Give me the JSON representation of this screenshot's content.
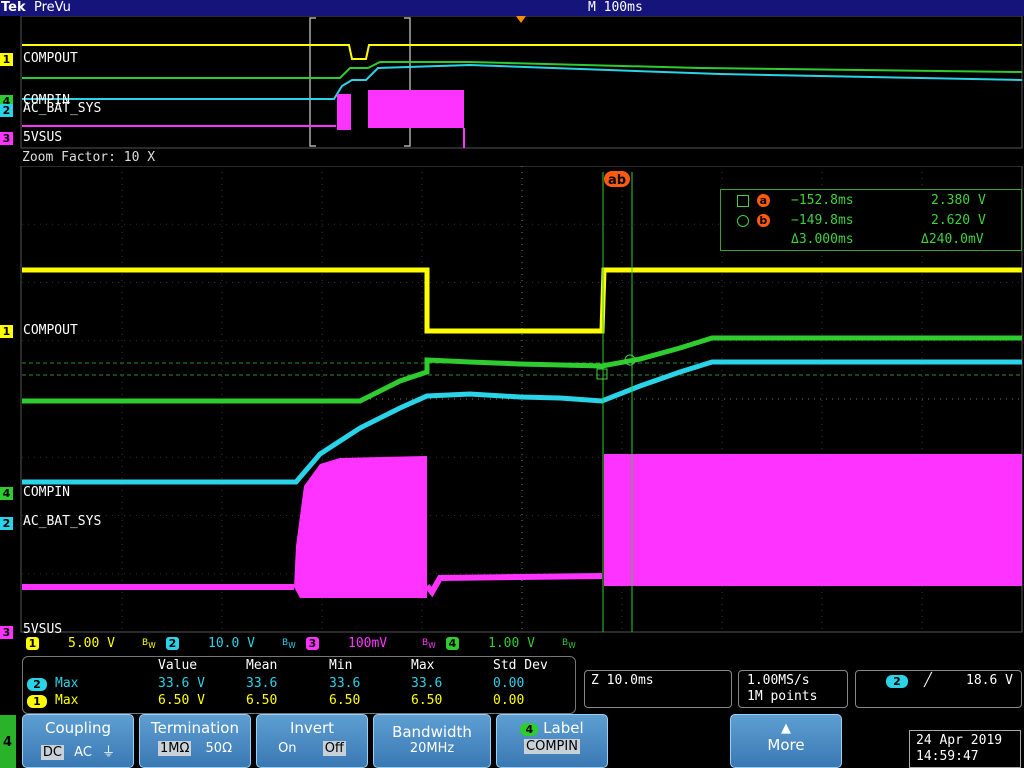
{
  "header": {
    "brand": "Tek",
    "mode": "PreVu",
    "timebase": "M 100ms"
  },
  "overview": {
    "labels": [
      {
        "mark": "1",
        "text": "COMPOUT",
        "color": "#ffff00"
      },
      {
        "mark": "4",
        "text": "COMPIN",
        "color": "#2ecc2e"
      },
      {
        "mark": "2",
        "text": "AC_BAT_SYS",
        "color": "#2ad4e8"
      },
      {
        "mark": "3",
        "text": "5VSUS",
        "color": "#ff33ff"
      }
    ]
  },
  "zoom": {
    "factor_text": "Zoom Factor: 10 X",
    "labels": [
      {
        "mark": "1",
        "text": "COMPOUT",
        "color": "#ffff00"
      },
      {
        "mark": "4",
        "text": "COMPIN",
        "color": "#2ecc2e"
      },
      {
        "mark": "2",
        "text": "AC_BAT_SYS",
        "color": "#2ad4e8"
      },
      {
        "mark": "3",
        "text": "5VSUS",
        "color": "#ff33ff"
      }
    ],
    "cursor_marker": "ab"
  },
  "cursors": {
    "a": {
      "badge": "a",
      "time": "−152.8ms",
      "value": "2.380 V"
    },
    "b": {
      "badge": "b",
      "time": "−149.8ms",
      "value": "2.620 V"
    },
    "delta_time": "Δ3.000ms",
    "delta_value": "Δ240.0mV"
  },
  "scales": [
    {
      "ch": "1",
      "value": "5.00 V",
      "color": "#ffff00"
    },
    {
      "ch": "2",
      "value": "10.0 V",
      "color": "#2ad4e8"
    },
    {
      "ch": "3",
      "value": "100mV",
      "color": "#ff33ff"
    },
    {
      "ch": "4",
      "value": "1.00 V",
      "color": "#2ecc2e"
    }
  ],
  "measurements": {
    "headers": [
      "Value",
      "Mean",
      "Min",
      "Max",
      "Std Dev"
    ],
    "rows": [
      {
        "ch": "2",
        "name": "Max",
        "color": "#2ad4e8",
        "cells": [
          "33.6 V",
          "33.6",
          "33.6",
          "33.6",
          "0.00"
        ]
      },
      {
        "ch": "1",
        "name": "Max",
        "color": "#ffff00",
        "cells": [
          "6.50 V",
          "6.50",
          "6.50",
          "6.50",
          "0.00"
        ]
      }
    ]
  },
  "acq": {
    "zoom_time": "Z 10.0ms",
    "sample_rate": "1.00MS/s",
    "record_length": "1M points",
    "trigger_ch": "2",
    "trigger_level": "18.6 V"
  },
  "side_channel": "4",
  "softkeys": {
    "coupling": {
      "title": "Coupling",
      "options": [
        "DC",
        "AC",
        "⏚"
      ]
    },
    "termination": {
      "title": "Termination",
      "options": [
        "1MΩ",
        "50Ω"
      ]
    },
    "invert": {
      "title": "Invert",
      "options": [
        "On",
        "Off"
      ]
    },
    "bandwidth": {
      "title": "Bandwidth",
      "value": "20MHz"
    },
    "label": {
      "ch": "4",
      "title": "Label",
      "value": "COMPIN"
    },
    "more": {
      "title": "More",
      "icon": "up-arrow-icon"
    }
  },
  "datetime": {
    "date": "24 Apr 2019",
    "time": "14:59:47"
  }
}
